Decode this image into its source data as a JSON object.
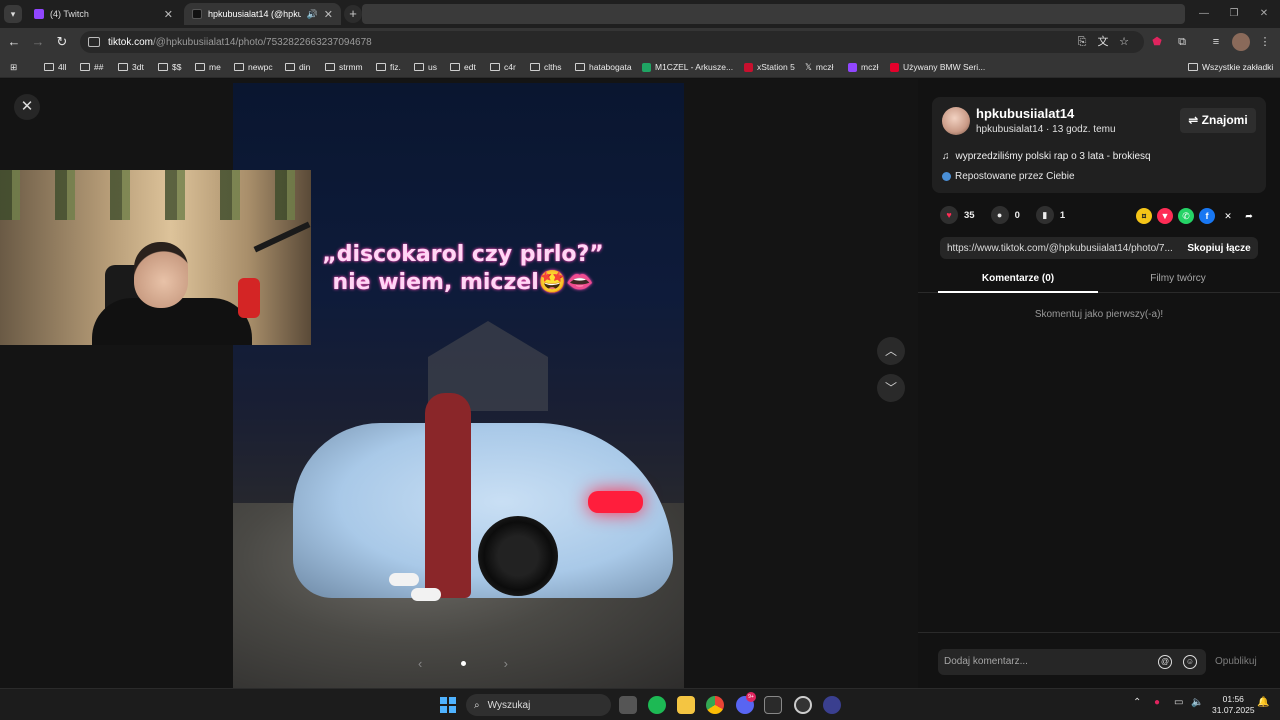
{
  "browser": {
    "tabs": [
      {
        "title": "(4) Twitch",
        "favicon_color": "#9146ff"
      },
      {
        "title": "hpkubusialat14 (@hpkubus",
        "favicon_color": "#111111"
      }
    ],
    "url_host": "tiktok.com",
    "url_path": "/@hpkubusiialat14/photo/7532822663237094678",
    "bookmarks": [
      {
        "label": "4ll",
        "type": "folder"
      },
      {
        "label": "##",
        "type": "folder"
      },
      {
        "label": "3dt",
        "type": "folder"
      },
      {
        "label": "$$",
        "type": "folder"
      },
      {
        "label": "me",
        "type": "folder"
      },
      {
        "label": "newpc",
        "type": "folder"
      },
      {
        "label": "din",
        "type": "folder"
      },
      {
        "label": "strmm",
        "type": "folder"
      },
      {
        "label": "fiz.",
        "type": "folder"
      },
      {
        "label": "us",
        "type": "folder"
      },
      {
        "label": "edt",
        "type": "folder"
      },
      {
        "label": "c4r",
        "type": "folder"
      },
      {
        "label": "clths",
        "type": "folder"
      },
      {
        "label": "hatabogata",
        "type": "folder"
      },
      {
        "label": "M1CZEL - Arkusze...",
        "type": "site",
        "color": "#1fa463"
      },
      {
        "label": "xStation 5",
        "type": "site",
        "color": "#c8102e"
      },
      {
        "label": "mczł",
        "type": "site",
        "color": "#000000"
      },
      {
        "label": "mczł",
        "type": "site",
        "color": "#9146ff"
      },
      {
        "label": "Używany BMW Seri...",
        "type": "site",
        "color": "#e4002b"
      }
    ],
    "all_bookmarks": "Wszystkie zakładki"
  },
  "post": {
    "overlay_line1": "„discokarol czy pirlo?”",
    "overlay_line2": "nie wiem, miczel🤩👄"
  },
  "panel": {
    "username": "hpkubusiialat14",
    "subline": "hpkubusialat14 · 13 godz. temu",
    "friends_button": "⇌ Znajomi",
    "music": "wyprzedziliśmy polski rap o 3 lata - brokiesq",
    "reposted": "Repostowane przez Ciebie",
    "likes": "35",
    "comments": "0",
    "saves": "1",
    "link": "https://www.tiktok.com/@hpkubusiialat14/photo/7...",
    "copy_button": "Skopiuj łącze",
    "tab_comments": "Komentarze (0)",
    "tab_creator": "Filmy twórcy",
    "empty_comments": "Skomentuj jako pierwszy(-a)!",
    "comment_placeholder": "Dodaj komentarz...",
    "publish": "Opublikuj"
  },
  "taskbar": {
    "search": "Wyszukaj",
    "discord_badge": "9+",
    "time": "01:56",
    "date": "31.07.2025"
  },
  "colors": {
    "like": "#fe2c55",
    "overlay_text": "#ffd6f5"
  }
}
